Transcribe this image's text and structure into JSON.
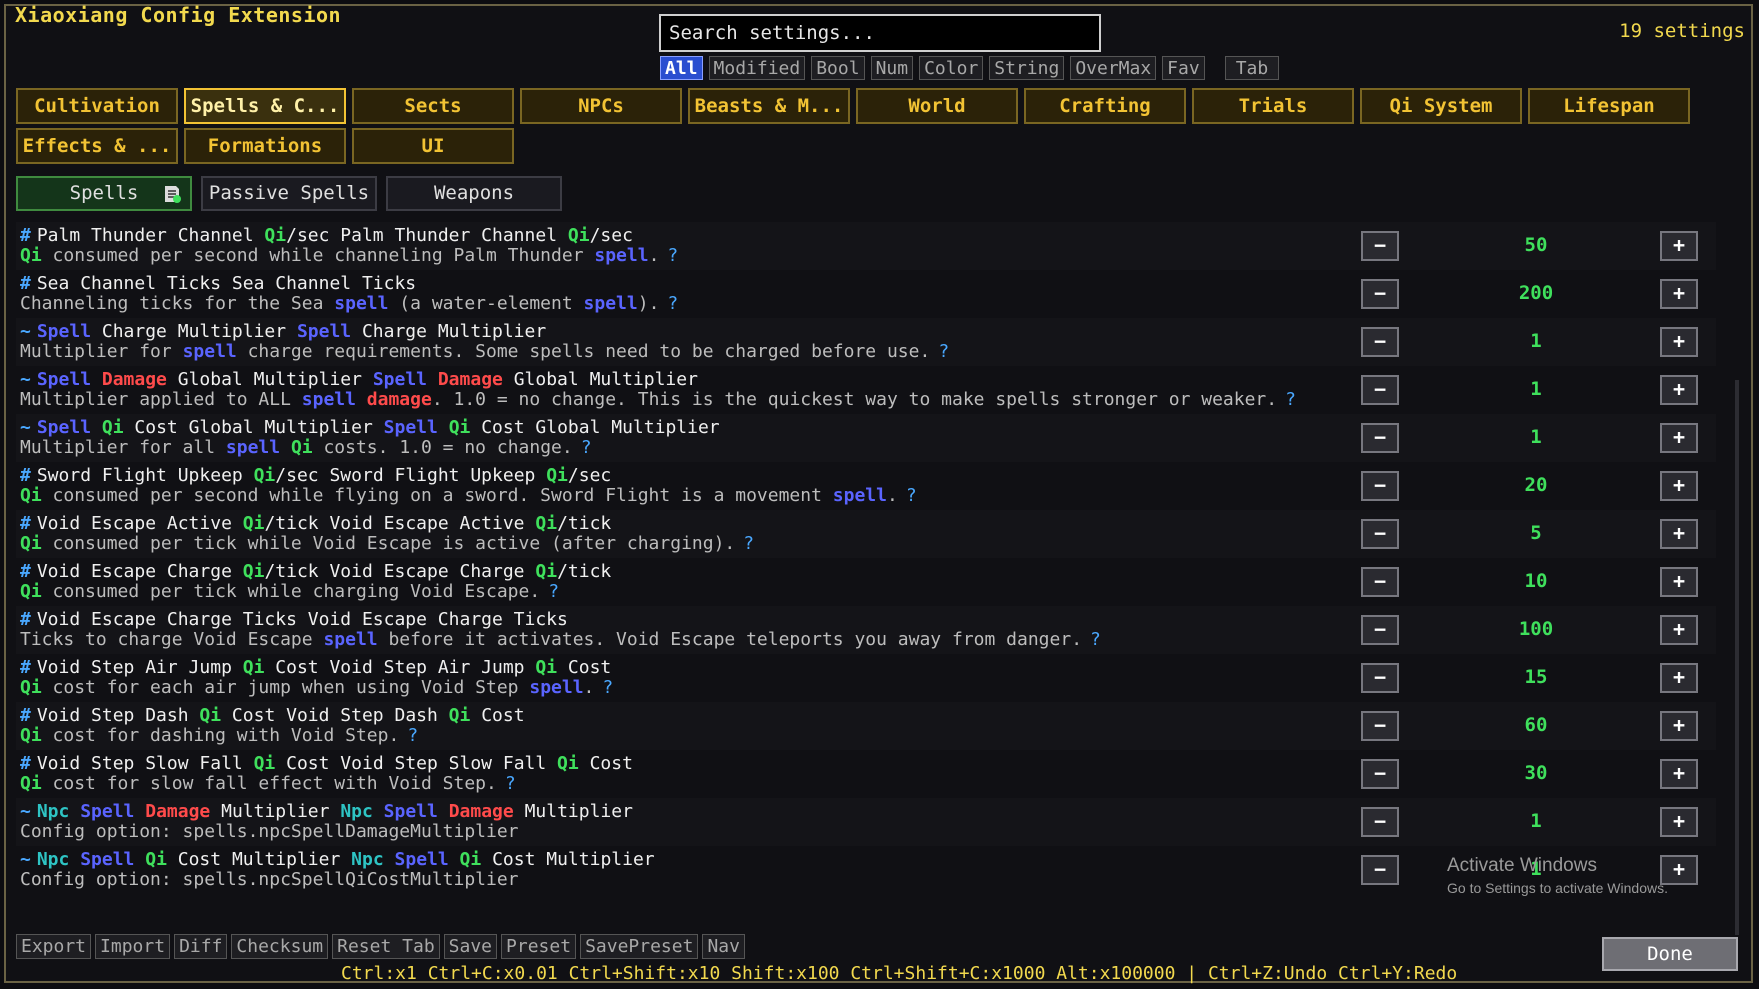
{
  "window": {
    "title": "Xiaoxiang Config Extension",
    "settings_count": "19 settings"
  },
  "search": {
    "placeholder": "Search settings..."
  },
  "filters": [
    "All",
    "Modified",
    "Bool",
    "Num",
    "Color",
    "String",
    "OverMax",
    "Fav"
  ],
  "filter_tab": "Tab",
  "categories": [
    "Cultivation",
    "Spells & C...",
    "Sects",
    "NPCs",
    "Beasts & M...",
    "World",
    "Crafting",
    "Trials",
    "Qi System",
    "Lifespan",
    "Effects & ...",
    "Formations",
    "UI"
  ],
  "subtabs": [
    "Spells",
    "Passive Spells",
    "Weapons"
  ],
  "settings": [
    {
      "prefix": "#",
      "value": "50",
      "title": [
        [
          "Palm Thunder Channel ",
          ""
        ],
        [
          "Qi",
          "q"
        ],
        [
          "/sec Palm Thunder Channel ",
          ""
        ],
        [
          "Qi",
          "q"
        ],
        [
          "/sec",
          ""
        ]
      ],
      "desc": [
        [
          "Qi",
          "q"
        ],
        [
          " consumed per second while channeling Palm Thunder ",
          ""
        ],
        [
          "spell",
          "s"
        ],
        [
          ".",
          ""
        ]
      ],
      "help": "?"
    },
    {
      "prefix": "#",
      "value": "200",
      "title": [
        [
          "Sea Channel Ticks Sea Channel Ticks",
          ""
        ]
      ],
      "desc": [
        [
          "Channeling ticks for the Sea ",
          ""
        ],
        [
          "spell",
          "s"
        ],
        [
          " (a water-element ",
          ""
        ],
        [
          "spell",
          "s"
        ],
        [
          ").",
          ""
        ]
      ],
      "help": "?"
    },
    {
      "prefix": "~",
      "value": "1",
      "title": [
        [
          "Spell",
          "s"
        ],
        [
          " Charge Multiplier ",
          ""
        ],
        [
          "Spell",
          "s"
        ],
        [
          " Charge Multiplier",
          ""
        ]
      ],
      "desc": [
        [
          "Multiplier for ",
          ""
        ],
        [
          "spell",
          "s"
        ],
        [
          " charge requirements. Some spells need to be charged before use.",
          ""
        ]
      ],
      "help": "?"
    },
    {
      "prefix": "~",
      "value": "1",
      "title": [
        [
          "Spell",
          "s"
        ],
        [
          " ",
          ""
        ],
        [
          "Damage",
          "d"
        ],
        [
          " Global Multiplier ",
          ""
        ],
        [
          "Spell",
          "s"
        ],
        [
          " ",
          ""
        ],
        [
          "Damage",
          "d"
        ],
        [
          " Global Multiplier",
          ""
        ]
      ],
      "desc": [
        [
          "Multiplier applied to ALL ",
          ""
        ],
        [
          "spell",
          "s"
        ],
        [
          " ",
          ""
        ],
        [
          "damage",
          "d"
        ],
        [
          ". 1.0 = no change. This is the quickest way to make spells stronger or weaker.",
          ""
        ]
      ],
      "help": "?"
    },
    {
      "prefix": "~",
      "value": "1",
      "title": [
        [
          "Spell",
          "s"
        ],
        [
          " ",
          ""
        ],
        [
          "Qi",
          "q"
        ],
        [
          " Cost Global Multiplier ",
          ""
        ],
        [
          "Spell",
          "s"
        ],
        [
          " ",
          ""
        ],
        [
          "Qi",
          "q"
        ],
        [
          " Cost Global Multiplier",
          ""
        ]
      ],
      "desc": [
        [
          "Multiplier for all ",
          ""
        ],
        [
          "spell",
          "s"
        ],
        [
          " ",
          ""
        ],
        [
          "Qi",
          "q"
        ],
        [
          " costs. 1.0 = no change.",
          ""
        ]
      ],
      "help": "?"
    },
    {
      "prefix": "#",
      "value": "20",
      "title": [
        [
          "Sword Flight Upkeep ",
          ""
        ],
        [
          "Qi",
          "q"
        ],
        [
          "/sec Sword Flight Upkeep ",
          ""
        ],
        [
          "Qi",
          "q"
        ],
        [
          "/sec",
          ""
        ]
      ],
      "desc": [
        [
          "Qi",
          "q"
        ],
        [
          " consumed per second while flying on a sword. Sword Flight is a movement ",
          ""
        ],
        [
          "spell",
          "s"
        ],
        [
          ".",
          ""
        ]
      ],
      "help": "?"
    },
    {
      "prefix": "#",
      "value": "5",
      "title": [
        [
          "Void Escape Active ",
          ""
        ],
        [
          "Qi",
          "q"
        ],
        [
          "/tick Void Escape Active ",
          ""
        ],
        [
          "Qi",
          "q"
        ],
        [
          "/tick",
          ""
        ]
      ],
      "desc": [
        [
          "Qi",
          "q"
        ],
        [
          " consumed per tick while Void Escape is active (after charging).",
          ""
        ]
      ],
      "help": "?"
    },
    {
      "prefix": "#",
      "value": "10",
      "title": [
        [
          "Void Escape Charge ",
          ""
        ],
        [
          "Qi",
          "q"
        ],
        [
          "/tick Void Escape Charge ",
          ""
        ],
        [
          "Qi",
          "q"
        ],
        [
          "/tick",
          ""
        ]
      ],
      "desc": [
        [
          "Qi",
          "q"
        ],
        [
          " consumed per tick while charging Void Escape.",
          ""
        ]
      ],
      "help": "?"
    },
    {
      "prefix": "#",
      "value": "100",
      "title": [
        [
          "Void Escape Charge Ticks Void Escape Charge Ticks",
          ""
        ]
      ],
      "desc": [
        [
          "Ticks to charge Void Escape ",
          ""
        ],
        [
          "spell",
          "s"
        ],
        [
          " before it activates. Void Escape teleports you away from danger.",
          ""
        ]
      ],
      "help": "?"
    },
    {
      "prefix": "#",
      "value": "15",
      "title": [
        [
          "Void Step Air Jump ",
          ""
        ],
        [
          "Qi",
          "q"
        ],
        [
          " Cost Void Step Air Jump ",
          ""
        ],
        [
          "Qi",
          "q"
        ],
        [
          " Cost",
          ""
        ]
      ],
      "desc": [
        [
          "Qi",
          "q"
        ],
        [
          " cost for each air jump when using Void Step ",
          ""
        ],
        [
          "spell",
          "s"
        ],
        [
          ".",
          ""
        ]
      ],
      "help": "?"
    },
    {
      "prefix": "#",
      "value": "60",
      "title": [
        [
          "Void Step Dash ",
          ""
        ],
        [
          "Qi",
          "q"
        ],
        [
          " Cost Void Step Dash ",
          ""
        ],
        [
          "Qi",
          "q"
        ],
        [
          " Cost",
          ""
        ]
      ],
      "desc": [
        [
          "Qi",
          "q"
        ],
        [
          " cost for dashing with Void Step.",
          ""
        ]
      ],
      "help": "?"
    },
    {
      "prefix": "#",
      "value": "30",
      "title": [
        [
          "Void Step Slow Fall ",
          ""
        ],
        [
          "Qi",
          "q"
        ],
        [
          " Cost Void Step Slow Fall ",
          ""
        ],
        [
          "Qi",
          "q"
        ],
        [
          " Cost",
          ""
        ]
      ],
      "desc": [
        [
          "Qi",
          "q"
        ],
        [
          " cost for slow fall effect with Void Step.",
          ""
        ]
      ],
      "help": "?"
    },
    {
      "prefix": "~",
      "value": "1",
      "title": [
        [
          "Npc",
          "n"
        ],
        [
          " ",
          ""
        ],
        [
          "Spell",
          "s"
        ],
        [
          " ",
          ""
        ],
        [
          "Damage",
          "d"
        ],
        [
          " Multiplier ",
          ""
        ],
        [
          "Npc",
          "n"
        ],
        [
          " ",
          ""
        ],
        [
          "Spell",
          "s"
        ],
        [
          " ",
          ""
        ],
        [
          "Damage",
          "d"
        ],
        [
          " Multiplier",
          ""
        ]
      ],
      "desc": [
        [
          "Config option: spells.npcSpellDamageMultiplier",
          ""
        ]
      ],
      "help": ""
    },
    {
      "prefix": "~",
      "value": "1",
      "title": [
        [
          "Npc",
          "n"
        ],
        [
          " ",
          ""
        ],
        [
          "Spell",
          "s"
        ],
        [
          " ",
          ""
        ],
        [
          "Qi",
          "q"
        ],
        [
          " Cost Multiplier ",
          ""
        ],
        [
          "Npc",
          "n"
        ],
        [
          " ",
          ""
        ],
        [
          "Spell",
          "s"
        ],
        [
          " ",
          ""
        ],
        [
          "Qi",
          "q"
        ],
        [
          " Cost Multiplier",
          ""
        ]
      ],
      "desc": [
        [
          "Config option: spells.npcSpellQiCostMultiplier",
          ""
        ]
      ],
      "help": ""
    }
  ],
  "controls": {
    "minus": "−",
    "plus": "+"
  },
  "bottom_buttons": [
    "Export",
    "Import",
    "Diff",
    "Checksum",
    "Reset Tab",
    "Save",
    "Preset",
    "SavePreset",
    "Nav"
  ],
  "done": "Done",
  "hint": "Ctrl:x1  Ctrl+C:x0.01  Ctrl+Shift:x10  Shift:x100  Ctrl+Shift+C:x1000  Alt:x100000  |  Ctrl+Z:Undo  Ctrl+Y:Redo",
  "watermark": {
    "line1": "Activate Windows",
    "line2": "Go to Settings to activate Windows."
  },
  "colors": {
    "accent_gold": "#f2c334",
    "qi_green": "#3fe05c",
    "spell_blue": "#5a64ff",
    "damage_red": "#ff4b4b",
    "npc_teal": "#2ec4c4"
  }
}
